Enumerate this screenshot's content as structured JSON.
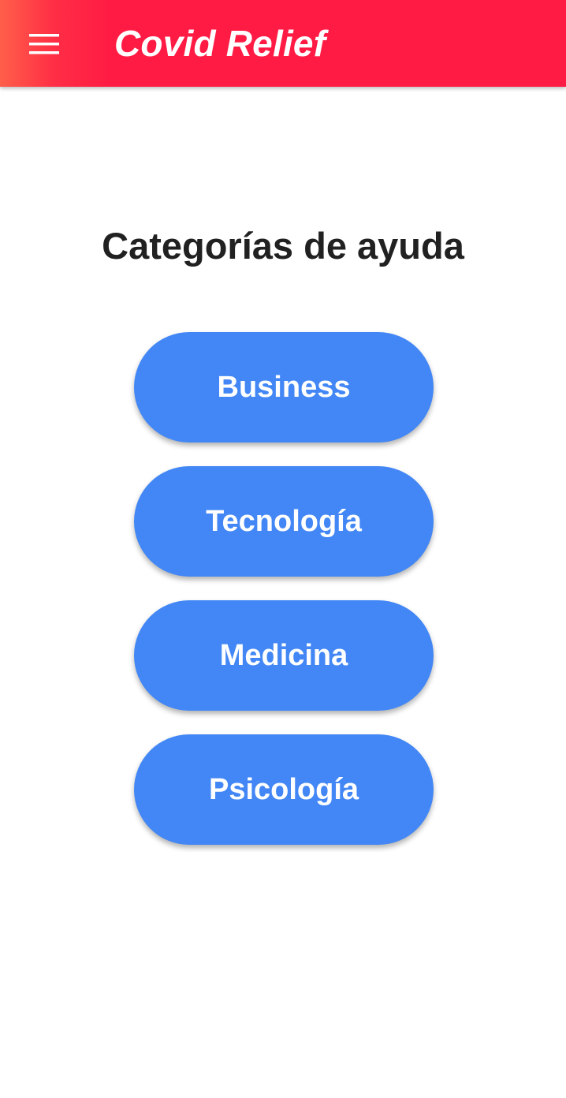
{
  "app_bar": {
    "menu_icon": "menu-icon",
    "title": "Covid Relief",
    "color": "#ff1b44"
  },
  "main": {
    "heading": "Categorías de ayuda",
    "button_color": "#4287f5",
    "categories": [
      {
        "label": "Business"
      },
      {
        "label": "Tecnología"
      },
      {
        "label": "Medicina"
      },
      {
        "label": "Psicología"
      }
    ]
  }
}
